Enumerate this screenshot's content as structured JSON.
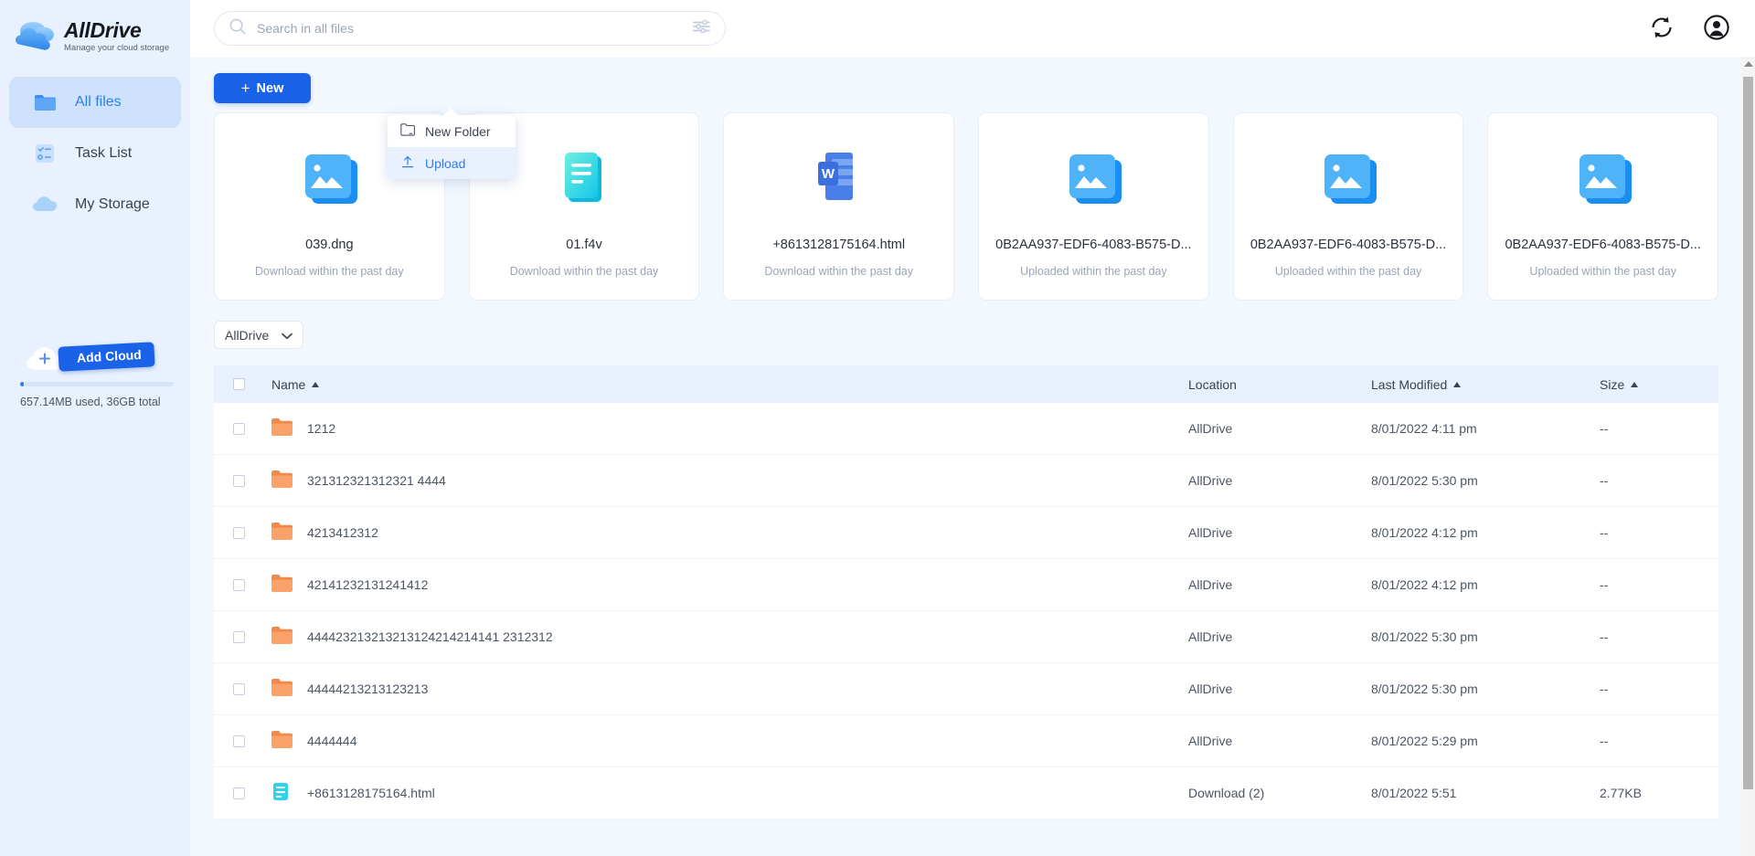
{
  "brand": {
    "name": "AllDrive",
    "tagline": "Manage your cloud storage",
    "logo_icon": "cloud-logo-icon"
  },
  "sidebar": {
    "items": [
      {
        "label": "All files",
        "icon": "folder-icon",
        "active": true
      },
      {
        "label": "Task List",
        "icon": "task-list-icon",
        "active": false
      },
      {
        "label": "My Storage",
        "icon": "cloud-icon",
        "active": false
      }
    ],
    "add_cloud": {
      "label": "Add Cloud",
      "icon": "plus-cloud-icon"
    },
    "storage": {
      "text": "657.14MB used, 36GB total",
      "percent": 2
    }
  },
  "topbar": {
    "search": {
      "placeholder": "Search in all files",
      "value": "",
      "icon": "search-icon",
      "filter_icon": "filter-icon"
    },
    "sync_icon": "sync-icon",
    "account_icon": "account-icon"
  },
  "toolbar": {
    "new_label": "New",
    "new_plus": "+",
    "dropdown": [
      {
        "label": "New Folder",
        "icon": "new-folder-icon",
        "selected": false
      },
      {
        "label": "Upload",
        "icon": "upload-arrow-icon",
        "selected": true
      }
    ]
  },
  "recent_cards": [
    {
      "name": "039.dng",
      "sub": "Download within the past day",
      "icon": "image-stack-icon"
    },
    {
      "name": "01.f4v",
      "sub": "Download within the past day",
      "icon": "text-document-icon"
    },
    {
      "name": "+8613128175164.html",
      "sub": "Download within the past day",
      "icon": "word-document-icon"
    },
    {
      "name": "0B2AA937-EDF6-4083-B575-D...",
      "sub": "Uploaded within the past day",
      "icon": "image-stack-icon"
    },
    {
      "name": "0B2AA937-EDF6-4083-B575-D...",
      "sub": "Uploaded within the past day",
      "icon": "image-stack-icon"
    },
    {
      "name": "0B2AA937-EDF6-4083-B575-D...",
      "sub": "Uploaded within the past day",
      "icon": "image-stack-icon"
    }
  ],
  "filter": {
    "selected": "AllDrive",
    "chevron_icon": "chevron-down-icon"
  },
  "table": {
    "columns": [
      {
        "label": "Name",
        "sorted": "asc"
      },
      {
        "label": "Location",
        "sorted": ""
      },
      {
        "label": "Last Modified",
        "sorted": "asc"
      },
      {
        "label": "Size",
        "sorted": "asc"
      }
    ],
    "rows": [
      {
        "name": "1212",
        "icon": "folder-icon",
        "location": "AllDrive",
        "modified": "8/01/2022 4:11 pm",
        "size": "--"
      },
      {
        "name": "321312321312321 4444",
        "icon": "folder-icon",
        "location": "AllDrive",
        "modified": "8/01/2022 5:30 pm",
        "size": "--"
      },
      {
        "name": "4213412312",
        "icon": "folder-icon",
        "location": "AllDrive",
        "modified": "8/01/2022 4:12 pm",
        "size": "--"
      },
      {
        "name": "42141232131241412",
        "icon": "folder-icon",
        "location": "AllDrive",
        "modified": "8/01/2022 4:12 pm",
        "size": "--"
      },
      {
        "name": "444423213213213124214214141 2312312",
        "icon": "folder-icon",
        "location": "AllDrive",
        "modified": "8/01/2022 5:30 pm",
        "size": "--"
      },
      {
        "name": "44444213213123213",
        "icon": "folder-icon",
        "location": "AllDrive",
        "modified": "8/01/2022 5:30 pm",
        "size": "--"
      },
      {
        "name": "4444444",
        "icon": "folder-icon",
        "location": "AllDrive",
        "modified": "8/01/2022 5:29 pm",
        "size": "--"
      },
      {
        "name": "+8613128175164.html",
        "icon": "text-document-icon",
        "location": "Download (2)",
        "modified": "8/01/2022 5:51",
        "size": "2.77KB"
      }
    ]
  },
  "colors": {
    "accent": "#1a63e8",
    "sidebar_bg": "#e8f1fd",
    "content_bg": "#f3f7fe",
    "folder_orange": "#f79256",
    "header_row": "#e8f0fd"
  }
}
